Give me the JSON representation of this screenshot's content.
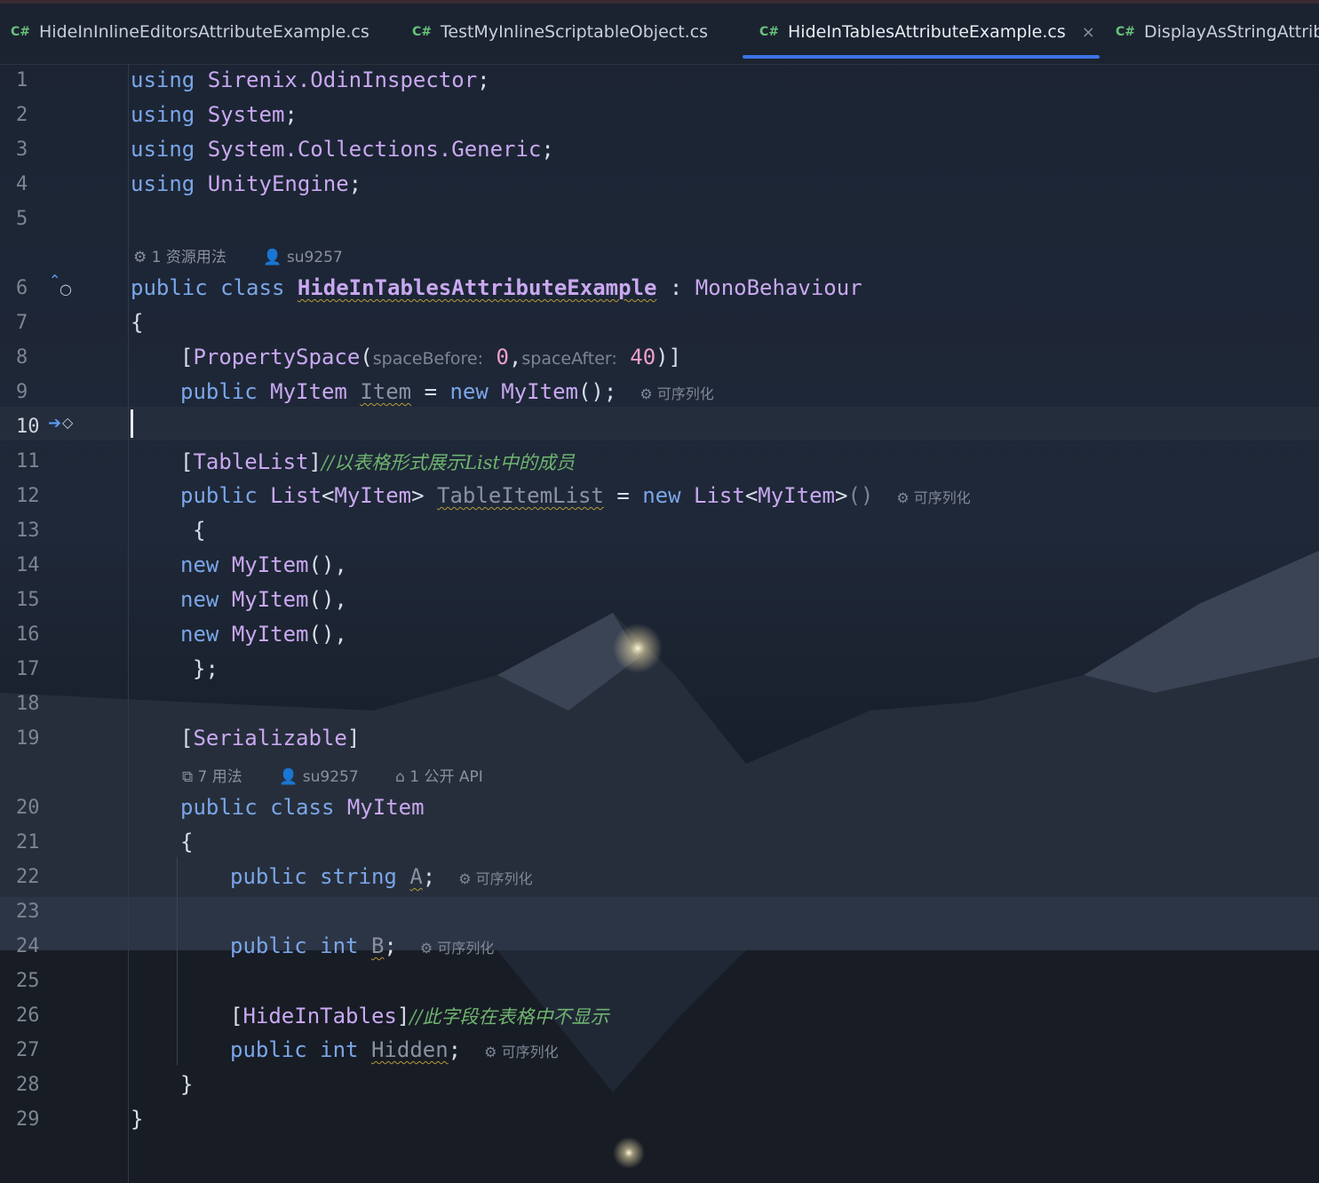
{
  "tabs": [
    {
      "badge": "C#",
      "label": "HideInInlineEditorsAttributeExample.cs"
    },
    {
      "badge": "C#",
      "label": "TestMyInlineScriptableObject.cs"
    },
    {
      "badge": "C#",
      "label": "HideInTablesAttributeExample.cs",
      "close": "×"
    },
    {
      "badge": "C#",
      "label": "DisplayAsStringAttribu"
    }
  ],
  "line_numbers": [
    "1",
    "2",
    "3",
    "4",
    "5",
    "6",
    "7",
    "8",
    "9",
    "10",
    "11",
    "12",
    "13",
    "14",
    "15",
    "16",
    "17",
    "18",
    "19",
    "20",
    "21",
    "22",
    "23",
    "24",
    "25",
    "26",
    "27",
    "28",
    "29"
  ],
  "code": {
    "using": "using",
    "l1_ns": "Sirenix.OdinInspector",
    "l2_ns": "System",
    "l3_ns": "System.Collections.Generic",
    "l4_ns": "UnityEngine",
    "semicolon": ";",
    "public": "public",
    "class": "class",
    "new": "new",
    "string": "string",
    "int": "int",
    "class_main": "HideInTablesAttributeExample",
    "colon": ":",
    "base_class": "MonoBehaviour",
    "open_brace": "{",
    "close_brace": "}",
    "close_brace_semi": "};",
    "property_space": "PropertySpace",
    "hint_space_before": "spaceBefore:",
    "val_0": "0",
    "hint_space_after": "spaceAfter:",
    "val_40": "40",
    "type_myitem": "MyItem",
    "field_item": "Item",
    "table_list_attr": "TableList",
    "comment_table_list": "//以表格形式展示List中的成员",
    "type_list": "List",
    "field_table_item_list": "TableItemList",
    "parens": "()",
    "parens_comma": "(),",
    "serializable": "Serializable",
    "class_myitem": "MyItem",
    "field_a": "A",
    "field_b": "B",
    "hide_in_tables_attr": "HideInTables",
    "comment_hide": "//此字段在表格中不显示",
    "field_hidden": "Hidden",
    "serializable_hint": "可序列化"
  },
  "lens": {
    "main_usages": "1 资源用法",
    "main_author": "su9257",
    "item_usages": "7 用法",
    "item_author": "su9257",
    "item_api": "1 公开 API"
  },
  "colors": {
    "tab_underline": "#3b74e6",
    "keyword": "#7aa6e8",
    "type": "#c9a8f0",
    "number": "#f0a0c8",
    "comment": "#6fb46f"
  }
}
